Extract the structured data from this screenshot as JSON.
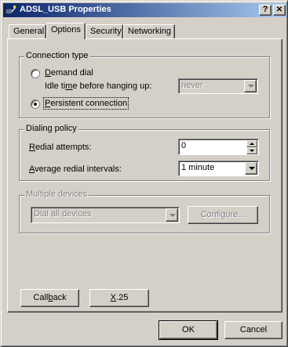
{
  "window": {
    "title": "ADSL_USB Properties",
    "help_glyph": "?",
    "close_glyph": "✕"
  },
  "tabs": [
    {
      "label": "General",
      "active": false
    },
    {
      "label": "Options",
      "active": true
    },
    {
      "label": "Security",
      "active": false
    },
    {
      "label": "Networking",
      "active": false
    }
  ],
  "connection_type": {
    "title": "Connection type",
    "demand_dial": {
      "prefix": "",
      "mnemonic": "D",
      "rest": "emand dial",
      "selected": false
    },
    "idle_label": {
      "prefix": "Idle ti",
      "mnemonic": "m",
      "rest": "e before hanging up:"
    },
    "idle_value": "never",
    "persistent": {
      "prefix": "",
      "mnemonic": "P",
      "rest": "ersistent connection",
      "selected": true
    }
  },
  "dialing_policy": {
    "title": "Dialing policy",
    "redial_label": {
      "prefix": "",
      "mnemonic": "R",
      "rest": "edial attempts:"
    },
    "redial_value": "0",
    "interval_label": {
      "prefix": "",
      "mnemonic": "A",
      "rest": "verage redial intervals:"
    },
    "interval_value": "1 minute"
  },
  "multiple_devices": {
    "title": "Multiple devices",
    "dial_value": "Dial all devices",
    "configure_label": "Configure..."
  },
  "buttons": {
    "callback": {
      "prefix": "Call",
      "mnemonic": "b",
      "rest": "ack"
    },
    "x25": {
      "prefix": "",
      "mnemonic": "X",
      "rest": ".25"
    },
    "ok": "OK",
    "cancel": "Cancel"
  },
  "colors": {
    "face": "#d4d0c8",
    "title_start": "#0a246a",
    "title_end": "#a6caf0",
    "disabled_text": "#808080"
  }
}
